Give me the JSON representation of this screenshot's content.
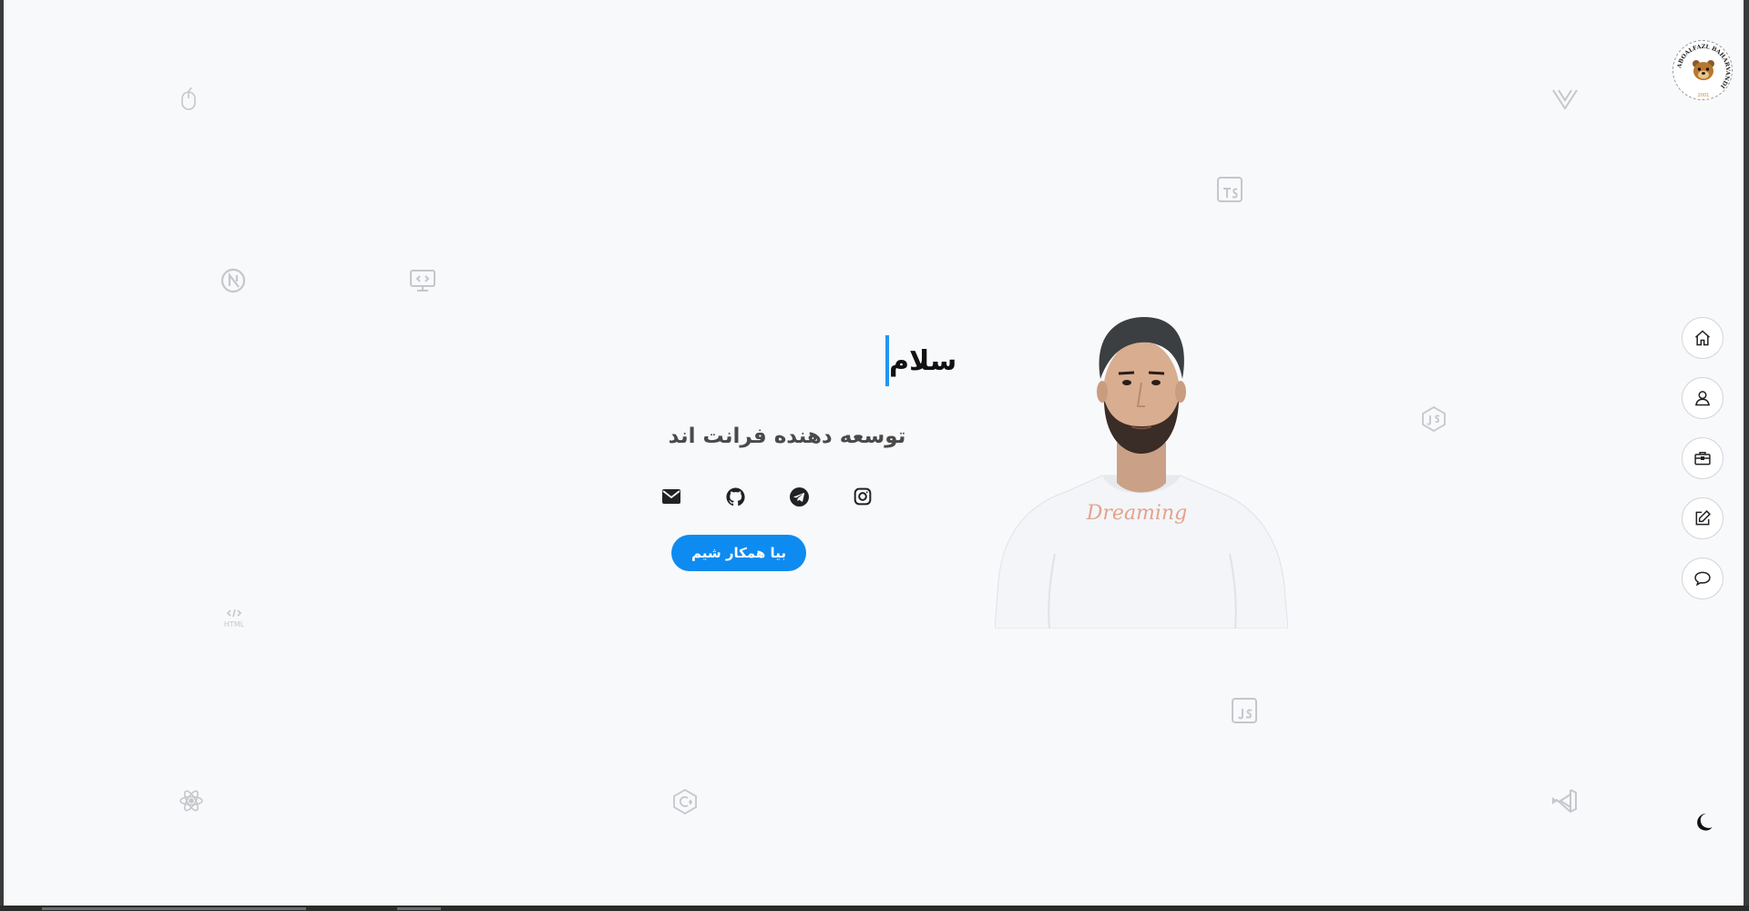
{
  "logo": {
    "name": "ABOALFAZL BAHARVANDI",
    "year": "2001"
  },
  "hero": {
    "greeting": "سلام",
    "role": "توسعه دهنده فرانت اند",
    "cta_label": "بیا همکار شیم",
    "socials": [
      {
        "icon": "mail-icon"
      },
      {
        "icon": "github-icon"
      },
      {
        "icon": "telegram-icon"
      },
      {
        "icon": "instagram-icon"
      }
    ]
  },
  "background_icons": [
    "mouse-icon",
    "vue-icon",
    "typescript-icon",
    "nextjs-icon",
    "monitor-code-icon",
    "nodejs-icon",
    "html-icon",
    "javascript-icon",
    "react-icon",
    "csharp-icon",
    "vscode-icon"
  ],
  "side_nav": [
    {
      "icon": "home-icon"
    },
    {
      "icon": "user-icon"
    },
    {
      "icon": "briefcase-icon"
    },
    {
      "icon": "edit-icon"
    },
    {
      "icon": "chat-icon"
    }
  ],
  "theme_toggle": {
    "icon": "moon-icon"
  },
  "colors": {
    "accent": "#0d8bf0",
    "caret": "#2196f3",
    "background": "#f8f9fb",
    "decor": "#c4c7cc"
  }
}
